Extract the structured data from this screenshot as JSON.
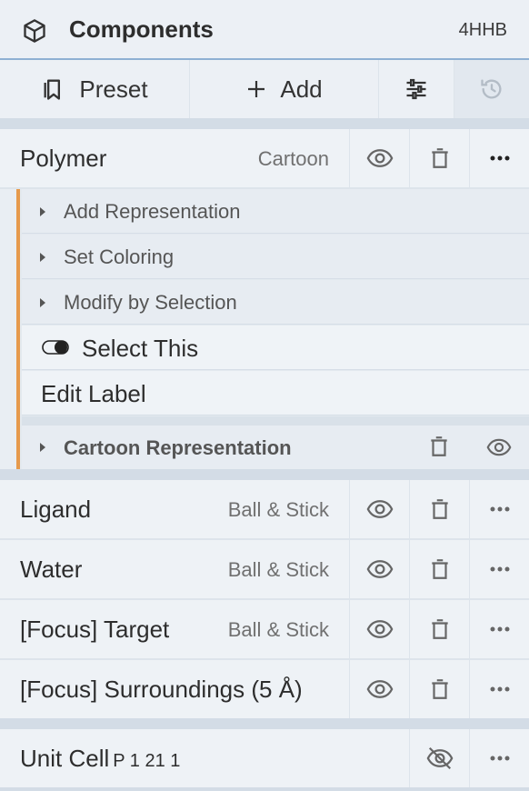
{
  "header": {
    "title": "Components",
    "pdb_id": "4HHB",
    "icon": "cube-icon"
  },
  "toolbar": {
    "preset_label": "Preset",
    "add_label": "Add",
    "preset_icon": "bookmark-icon",
    "add_icon": "plus-icon",
    "options_icon": "sliders-icon",
    "history_icon": "history-icon"
  },
  "polymer": {
    "name": "Polymer",
    "representation": "Cartoon",
    "submenu": {
      "add_representation": "Add Representation",
      "set_coloring": "Set Coloring",
      "modify_by_selection": "Modify by Selection",
      "select_this": "Select This",
      "edit_label": "Edit Label",
      "cartoon_representation": "Cartoon Representation"
    }
  },
  "components": [
    {
      "name": "Ligand",
      "representation": "Ball & Stick"
    },
    {
      "name": "Water",
      "representation": "Ball & Stick"
    },
    {
      "name": "[Focus] Target",
      "representation": "Ball & Stick"
    },
    {
      "name": "[Focus] Surroundings (5 Å)",
      "representation": ""
    }
  ],
  "unit_cell": {
    "name": "Unit Cell",
    "space_group": "P 1 21 1"
  },
  "colors": {
    "accent": "#e69a4c",
    "header_border": "#8fb0d3",
    "row_bg": "#eef2f6",
    "icon": "#666666"
  }
}
